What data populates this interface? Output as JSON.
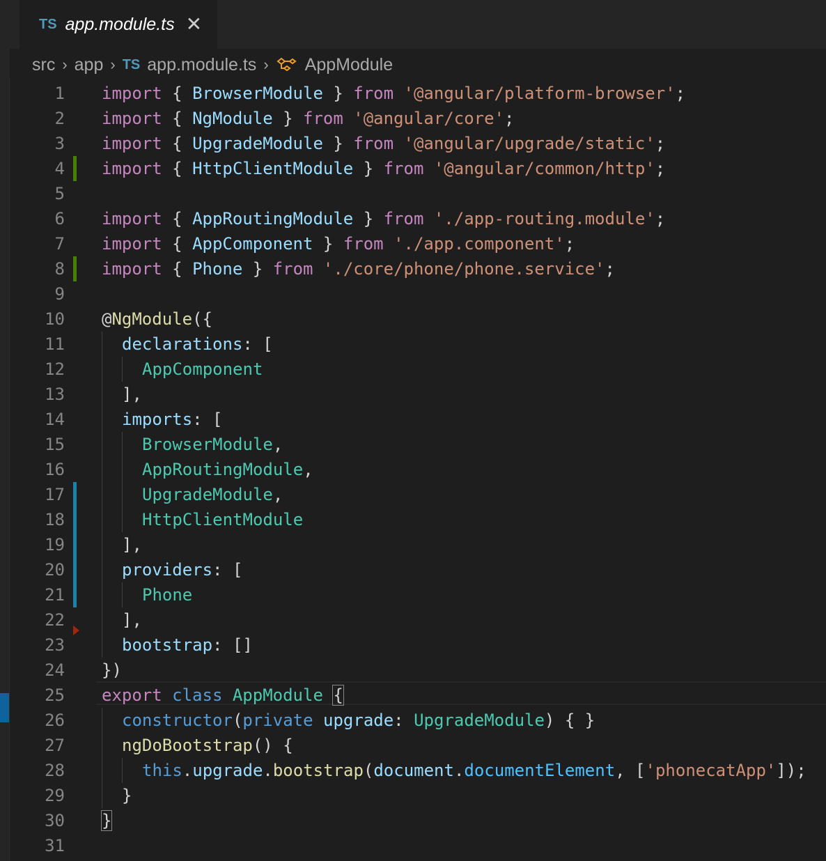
{
  "tab": {
    "lang_badge": "TS",
    "title": "app.module.ts",
    "close_glyph": "✕"
  },
  "breadcrumb": {
    "items": [
      "src",
      "app",
      "app.module.ts",
      "AppModule"
    ],
    "lang_badge": "TS",
    "separator": "›",
    "symbol_icon": "class-symbol-icon"
  },
  "editor": {
    "line_numbers": [
      "1",
      "2",
      "3",
      "4",
      "5",
      "6",
      "7",
      "8",
      "9",
      "10",
      "11",
      "12",
      "13",
      "14",
      "15",
      "16",
      "17",
      "18",
      "19",
      "20",
      "21",
      "22",
      "23",
      "24",
      "25",
      "26",
      "27",
      "28",
      "29",
      "30",
      "31"
    ],
    "code": {
      "l1": {
        "k1": "import",
        "a": " { ",
        "n": "BrowserModule",
        "b": " } ",
        "k2": "from",
        "c": " ",
        "s": "'@angular/platform-browser'",
        "e": ";"
      },
      "l2": {
        "k1": "import",
        "a": " { ",
        "n": "NgModule",
        "b": " } ",
        "k2": "from",
        "c": " ",
        "s": "'@angular/core'",
        "e": ";"
      },
      "l3": {
        "k1": "import",
        "a": " { ",
        "n": "UpgradeModule",
        "b": " } ",
        "k2": "from",
        "c": " ",
        "s": "'@angular/upgrade/static'",
        "e": ";"
      },
      "l4": {
        "k1": "import",
        "a": " { ",
        "n": "HttpClientModule",
        "b": " } ",
        "k2": "from",
        "c": " ",
        "s": "'@angular/common/http'",
        "e": ";"
      },
      "l6": {
        "k1": "import",
        "a": " { ",
        "n": "AppRoutingModule",
        "b": " } ",
        "k2": "from",
        "c": " ",
        "s": "'./app-routing.module'",
        "e": ";"
      },
      "l7": {
        "k1": "import",
        "a": " { ",
        "n": "AppComponent",
        "b": " } ",
        "k2": "from",
        "c": " ",
        "s": "'./app.component'",
        "e": ";"
      },
      "l8": {
        "k1": "import",
        "a": " { ",
        "n": "Phone",
        "b": " } ",
        "k2": "from",
        "c": " ",
        "s": "'./core/phone/phone.service'",
        "e": ";"
      },
      "l10": {
        "at": "@",
        "dec": "NgModule",
        "p": "({"
      },
      "l11": {
        "prop": "declarations",
        "p": ": ["
      },
      "l12": {
        "t": "AppComponent"
      },
      "l13": {
        "p": "],"
      },
      "l14": {
        "prop": "imports",
        "p": ": ["
      },
      "l15": {
        "t": "BrowserModule",
        "p": ","
      },
      "l16": {
        "t": "AppRoutingModule",
        "p": ","
      },
      "l17": {
        "t": "UpgradeModule",
        "p": ","
      },
      "l18": {
        "t": "HttpClientModule"
      },
      "l19": {
        "p": "],"
      },
      "l20": {
        "prop": "providers",
        "p": ": ["
      },
      "l21": {
        "t": "Phone"
      },
      "l22": {
        "p": "],"
      },
      "l23": {
        "prop": "bootstrap",
        "p": ": []"
      },
      "l24": {
        "p": "})"
      },
      "l25": {
        "k1": "export",
        "sp1": " ",
        "k2": "class",
        "sp2": " ",
        "t": "AppModule",
        "sp3": " ",
        "brace": "{"
      },
      "l26": {
        "f": "constructor",
        "p1": "(",
        "mod": "private",
        "sp": " ",
        "v": "upgrade",
        "p2": ": ",
        "t": "UpgradeModule",
        "p3": ") { }"
      },
      "l27": {
        "f": "ngDoBootstrap",
        "p": "() {"
      },
      "l28": {
        "this": "this",
        "d1": ".",
        "v1": "upgrade",
        "d2": ".",
        "f": "bootstrap",
        "p1": "(",
        "v2": "document",
        "d3": ".",
        "c": "documentElement",
        "p2": ", [",
        "s": "'phonecatApp'",
        "p3": "]);"
      },
      "l29": {
        "p": "}"
      },
      "l30": {
        "brace": "}"
      }
    }
  },
  "colors": {
    "background": "#1e1e1e",
    "keyword": "#c586c0",
    "variable": "#9cdcfe",
    "string": "#ce9178",
    "type": "#4ec9b0",
    "function": "#dcdcaa",
    "storage": "#569cd6",
    "constant": "#4fc1ff",
    "gutter_added": "#487e02",
    "gutter_modified": "#1b81a8",
    "gutter_deleted": "#a1260d"
  }
}
